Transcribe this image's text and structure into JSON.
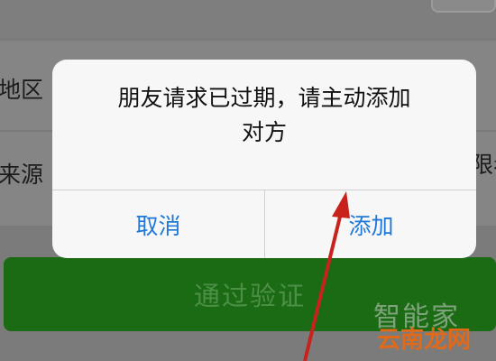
{
  "background": {
    "row_labels": [
      "地区",
      "来源"
    ],
    "right_partial_label": "限看",
    "primary_button_label": "通过验证"
  },
  "dialog": {
    "message": "朋友请求已过期，请主动添加\n对方",
    "cancel_label": "取消",
    "add_label": "添加"
  },
  "watermark": {
    "line1": "智能家",
    "line2": "云南龙网"
  },
  "colors": {
    "dialog_button_text": "#1f78d8",
    "primary_button_bg": "#1a6b14",
    "annotation_arrow": "#c8221c"
  }
}
